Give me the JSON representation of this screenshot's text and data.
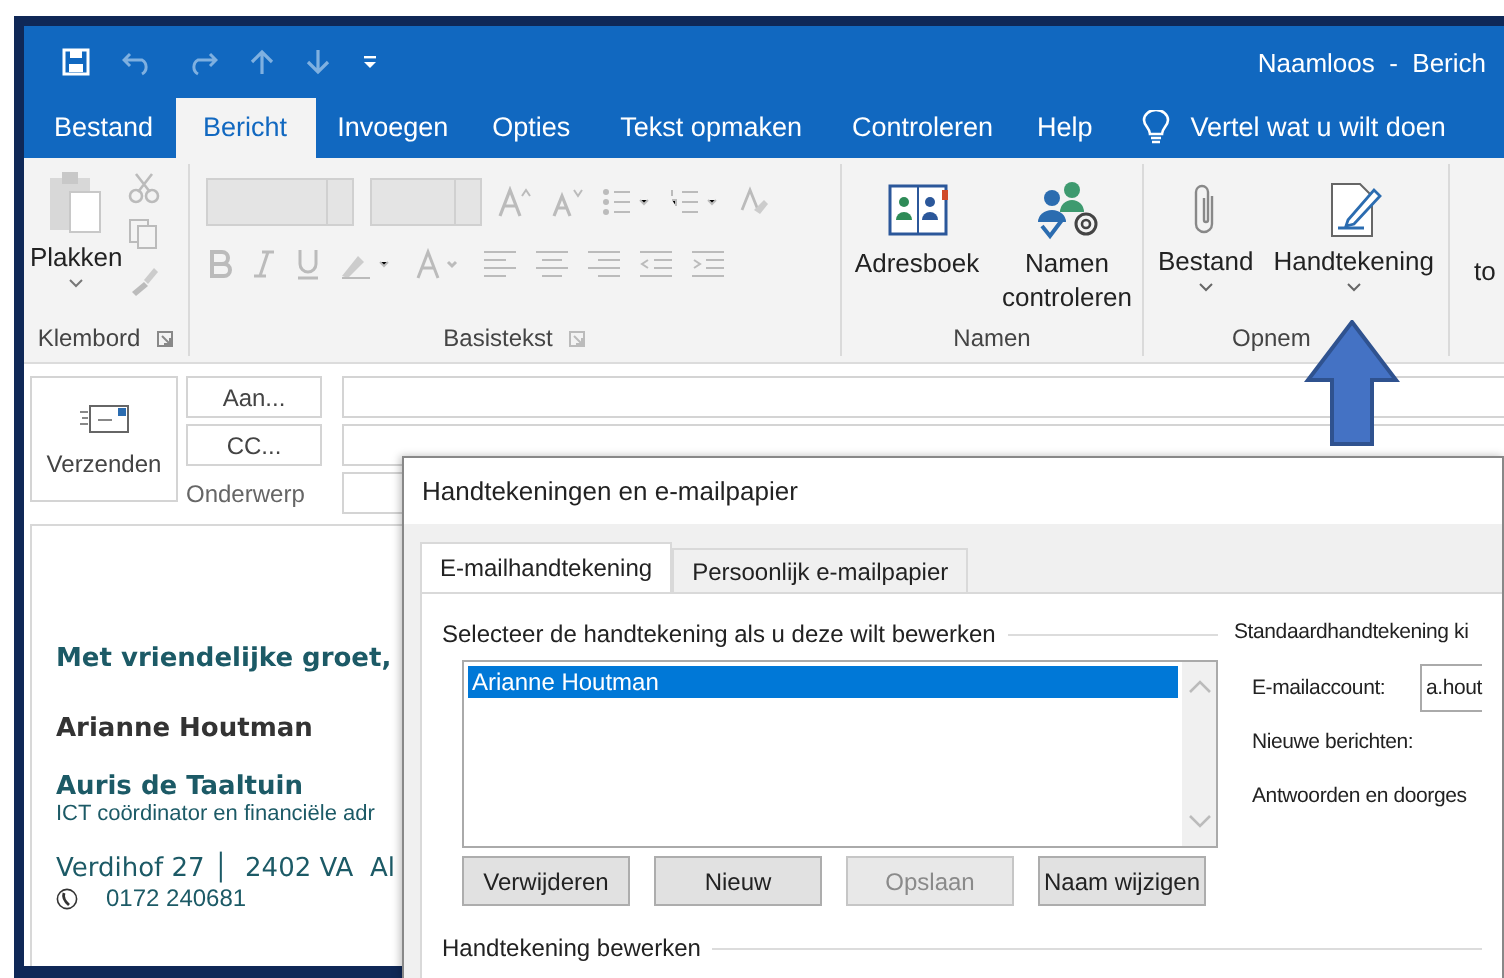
{
  "window": {
    "title": "Naamloos  -  Berich"
  },
  "menu_tabs": [
    {
      "label": "Bestand",
      "selected": false
    },
    {
      "label": "Bericht",
      "selected": true
    },
    {
      "label": "Invoegen",
      "selected": false
    },
    {
      "label": "Opties",
      "selected": false
    },
    {
      "label": "Tekst opmaken",
      "selected": false
    },
    {
      "label": "Controleren",
      "selected": false
    },
    {
      "label": "Help",
      "selected": false
    }
  ],
  "tell_me": "Vertel wat u wilt doen",
  "ribbon": {
    "clipboard": {
      "label": "Klembord",
      "paste": "Plakken"
    },
    "basic_text": {
      "label": "Basistekst"
    },
    "names": {
      "label": "Namen",
      "buttons": [
        {
          "label": "Adresboek",
          "kind": "book"
        },
        {
          "label": "Namen controleren",
          "kind": "people"
        }
      ]
    },
    "include": {
      "label": "Opnem",
      "buttons": [
        {
          "label": "Bestand",
          "kind": "clip"
        },
        {
          "label": "Handtekening",
          "kind": "signature"
        }
      ]
    },
    "cut_button": "to"
  },
  "message": {
    "send": "Verzenden",
    "to": "Aan...",
    "cc": "CC...",
    "subject_label": "Onderwerp"
  },
  "body": [
    {
      "kind": "greeting",
      "text": "Met vriendelijke groet,"
    },
    {
      "kind": "name",
      "text": "Arianne Houtman"
    },
    {
      "kind": "company",
      "text": "Auris de Taaltuin"
    },
    {
      "kind": "role",
      "text": "ICT coördinator en financiële adr"
    },
    {
      "kind": "address",
      "text": "Verdihof 27 │  2402 VA  Al"
    },
    {
      "kind": "phone",
      "text": "0172 240681"
    }
  ],
  "dialog": {
    "title": "Handtekeningen en e-mailpapier",
    "tabs": [
      {
        "label": "E-mailhandtekening",
        "selected": true
      },
      {
        "label": "Persoonlijk e-mailpapier",
        "selected": false
      }
    ],
    "select_label": "Selecteer de handtekening als u deze wilt bewerken",
    "signatures": [
      {
        "name": "Arianne Houtman",
        "selected": true
      }
    ],
    "buttons": [
      {
        "label": "Verwijderen",
        "disabled": false
      },
      {
        "label": "Nieuw",
        "disabled": false
      },
      {
        "label": "Opslaan",
        "disabled": true
      },
      {
        "label": "Naam wijzigen",
        "disabled": false
      }
    ],
    "edit_label": "Handtekening bewerken",
    "default_label": "Standaardhandtekening ki",
    "account_label": "E-mailaccount:",
    "account_value": "a.hout",
    "new_label": "Nieuwe berichten:",
    "reply_label": "Antwoorden en doorges"
  }
}
